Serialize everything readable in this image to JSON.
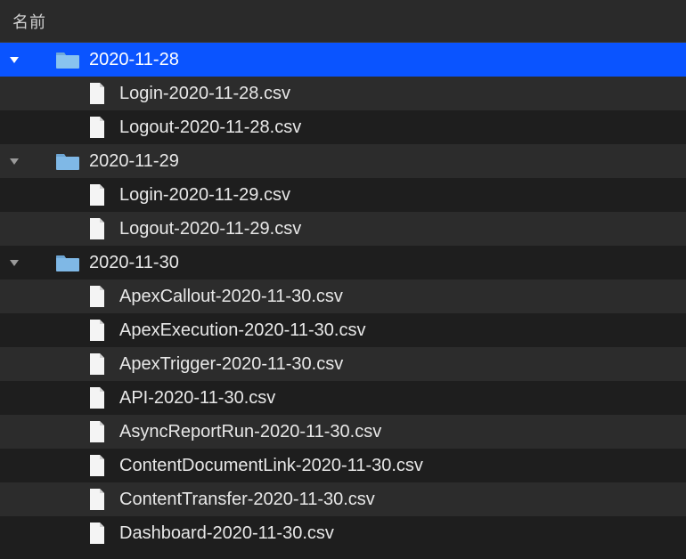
{
  "header": {
    "title": "名前"
  },
  "tree": [
    {
      "type": "folder",
      "name": "2020-11-28",
      "selected": true,
      "files": [
        {
          "name": "Login-2020-11-28.csv"
        },
        {
          "name": "Logout-2020-11-28.csv"
        }
      ]
    },
    {
      "type": "folder",
      "name": "2020-11-29",
      "selected": false,
      "files": [
        {
          "name": "Login-2020-11-29.csv"
        },
        {
          "name": "Logout-2020-11-29.csv"
        }
      ]
    },
    {
      "type": "folder",
      "name": "2020-11-30",
      "selected": false,
      "files": [
        {
          "name": "ApexCallout-2020-11-30.csv"
        },
        {
          "name": "ApexExecution-2020-11-30.csv"
        },
        {
          "name": "ApexTrigger-2020-11-30.csv"
        },
        {
          "name": "API-2020-11-30.csv"
        },
        {
          "name": "AsyncReportRun-2020-11-30.csv"
        },
        {
          "name": "ContentDocumentLink-2020-11-30.csv"
        },
        {
          "name": "ContentTransfer-2020-11-30.csv"
        },
        {
          "name": "Dashboard-2020-11-30.csv"
        }
      ]
    }
  ]
}
